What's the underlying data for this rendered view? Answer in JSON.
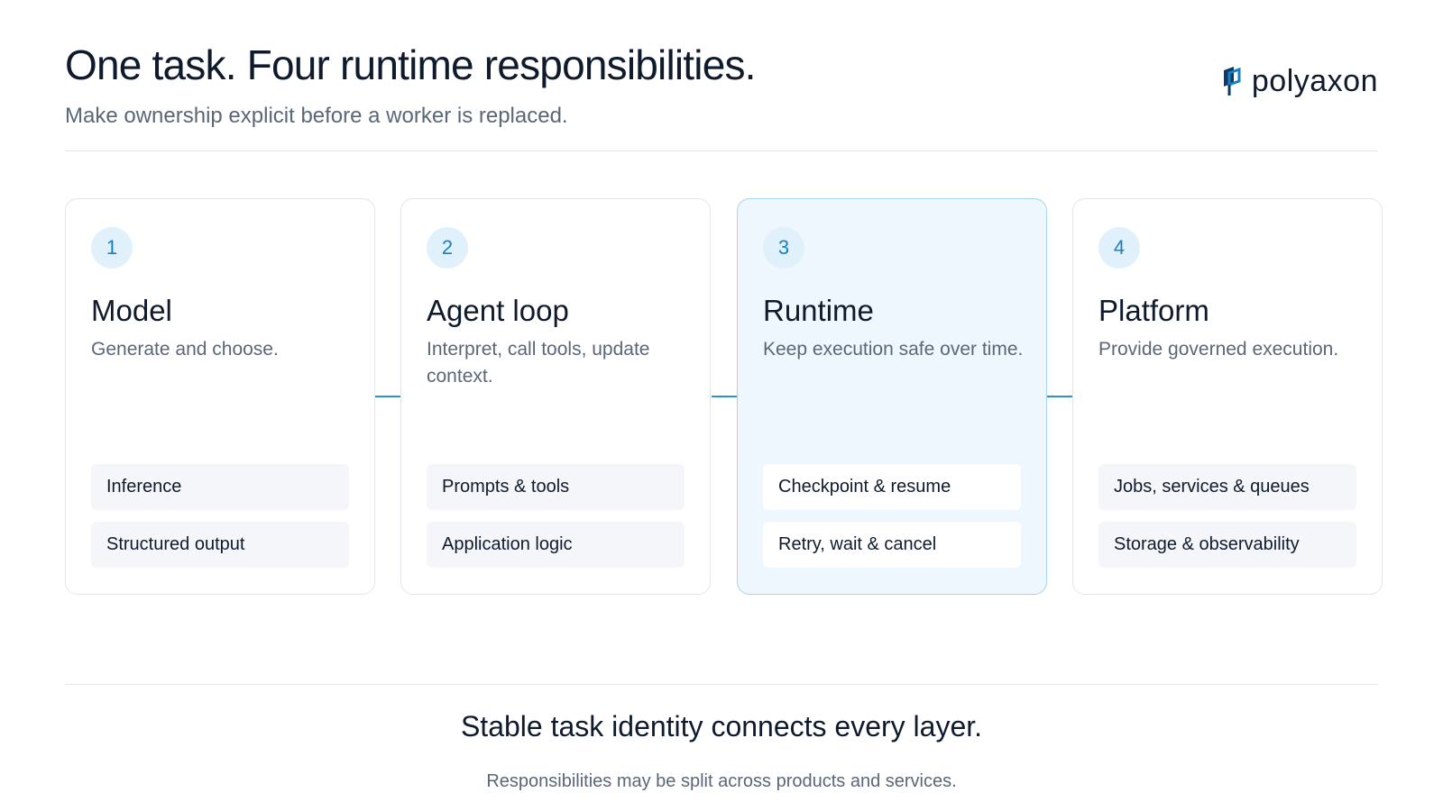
{
  "header": {
    "title": "One task. Four runtime responsibilities.",
    "subtitle": "Make ownership explicit before a worker is replaced."
  },
  "logo": {
    "text": "polyaxon",
    "icon": "polyaxon-logo-icon"
  },
  "colors": {
    "accent": "#1580c4",
    "badge_bg": "#e1f1fb",
    "active_card_bg": "#eef7fd",
    "connector": "#2f8fcf",
    "chip_bg": "#f4f6f9"
  },
  "cards": [
    {
      "number": "1",
      "title": "Model",
      "description": "Generate and choose.",
      "items": [
        "Inference",
        "Structured output"
      ],
      "active": false
    },
    {
      "number": "2",
      "title": "Agent loop",
      "description": "Interpret, call tools, update context.",
      "items": [
        "Prompts & tools",
        "Application logic"
      ],
      "active": false
    },
    {
      "number": "3",
      "title": "Runtime",
      "description": "Keep execution safe over time.",
      "items": [
        "Checkpoint & resume",
        "Retry, wait & cancel"
      ],
      "active": true
    },
    {
      "number": "4",
      "title": "Platform",
      "description": "Provide governed execution.",
      "items": [
        "Jobs, services & queues",
        "Storage & observability"
      ],
      "active": false
    }
  ],
  "footer": {
    "title": "Stable task identity connects every layer.",
    "note": "Responsibilities may be split across products and services."
  }
}
